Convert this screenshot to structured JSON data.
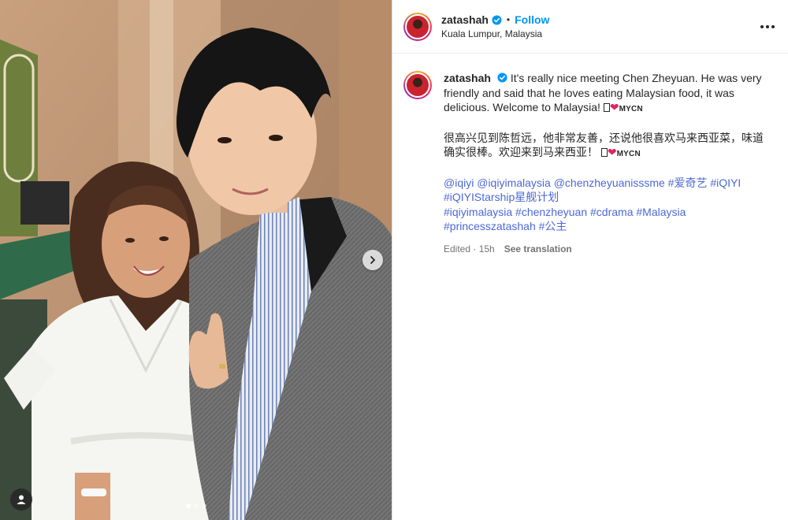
{
  "post": {
    "username": "zatashah",
    "follow_label": "Follow",
    "separator": "•",
    "location": "Kuala Lumpur, Malaysia"
  },
  "caption": {
    "username": "zatashah",
    "text_en": "It's really nice meeting Chen Zheyuan. He was very friendly and said that he loves eating Malaysian food, it was delicious. Welcome to Malaysia!",
    "text_cn": "很高兴见到陈哲远，他非常友善，还说他很喜欢马来西亚菜，味道确实很棒。欢迎来到马来西亚！",
    "flag_heart": "❤",
    "flag_label": "MYCN",
    "mentions": [
      "@iqiyi",
      "@iqiyimalaysia",
      "@chenzheyuanisssme"
    ],
    "hashtags_line1": [
      "#爱奇艺",
      "#iQIYI"
    ],
    "hashtags_line2": [
      "#iQIYIStarship星舰计划"
    ],
    "hashtags_line3": [
      "#iqiyimalaysia",
      "#chenzheyuan",
      "#cdrama",
      "#Malaysia"
    ],
    "hashtags_line4": [
      "#princesszatashah",
      "#公主"
    ],
    "edited": "Edited · 15h",
    "see_translation": "See translation"
  },
  "carousel": {
    "slides": 3,
    "current": 1
  },
  "colors": {
    "link": "#00376b",
    "hashtag": "#4c68d7",
    "follow": "#0095f6",
    "heart": "#e0245e"
  },
  "icons": [
    "verified-badge-icon",
    "more-options-icon",
    "next-arrow-icon",
    "user-tag-icon"
  ]
}
